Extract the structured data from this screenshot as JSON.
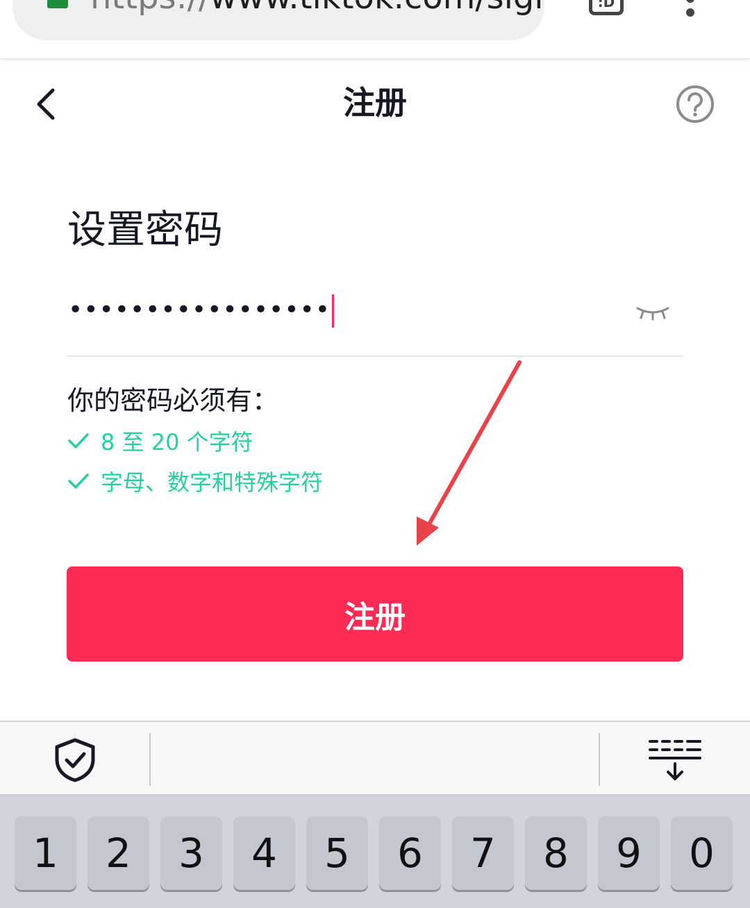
{
  "browser": {
    "url_scheme": "https://",
    "url_rest": "www.tiktok.com/sign",
    "tab_count": ":D"
  },
  "header": {
    "title": "注册"
  },
  "form": {
    "heading": "设置密码",
    "password_masked": "•••••••••••••••••",
    "requirements_title": "你的密码必须有：",
    "requirements": [
      "8 至 20 个字符",
      "字母、数字和特殊字符"
    ],
    "submit_label": "注册"
  },
  "keyboard": {
    "keys": [
      "1",
      "2",
      "3",
      "4",
      "5",
      "6",
      "7",
      "8",
      "9",
      "0"
    ]
  },
  "colors": {
    "accent": "#fe2c55",
    "success": "#25d0a0",
    "annotation": "#e8424a"
  }
}
